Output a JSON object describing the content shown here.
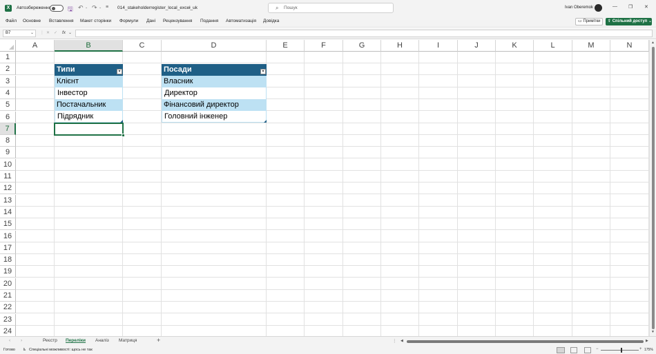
{
  "titlebar": {
    "autosave_label": "Автозбереження",
    "file_name": "014_stakeholderregister_local_excel_uk",
    "search_placeholder": "Пошук",
    "user_name": "Ivan Oberemok",
    "minimize": "—",
    "restore": "❐",
    "close": "✕"
  },
  "menu": [
    "Файл",
    "Основне",
    "Вставлення",
    "Макет сторінки",
    "Формули",
    "Дані",
    "Рецензування",
    "Подання",
    "Автоматизація",
    "Довідка"
  ],
  "ribbon_right": {
    "comments_label": "Примітки",
    "share_label": "Спільний доступ"
  },
  "formulabar": {
    "name_box": "B7",
    "fx": "fx",
    "formula": ""
  },
  "columns": [
    "A",
    "B",
    "C",
    "D",
    "E",
    "F",
    "G",
    "H",
    "I",
    "J",
    "K",
    "L",
    "M",
    "N"
  ],
  "rows": [
    "1",
    "2",
    "3",
    "4",
    "5",
    "6",
    "7",
    "8",
    "9",
    "10",
    "11",
    "12",
    "13",
    "14",
    "15",
    "16",
    "17",
    "18",
    "19",
    "20",
    "21",
    "22",
    "23",
    "24"
  ],
  "table_types": {
    "header": "Типи",
    "items": [
      "Клієнт",
      "Інвестор",
      "Постачальник",
      "Підрядник"
    ]
  },
  "table_positions": {
    "header": "Посади",
    "items": [
      "Власник",
      "Директор",
      "Фінансовий директор",
      "Головний інженер"
    ]
  },
  "sheet_tabs": [
    "Реєстр",
    "Переліки",
    "Аналіз",
    "Матриця"
  ],
  "active_sheet": "Переліки",
  "status": {
    "ready": "Готово",
    "accessibility": "Спеціальні можливості: щось не так",
    "zoom": "175%"
  }
}
